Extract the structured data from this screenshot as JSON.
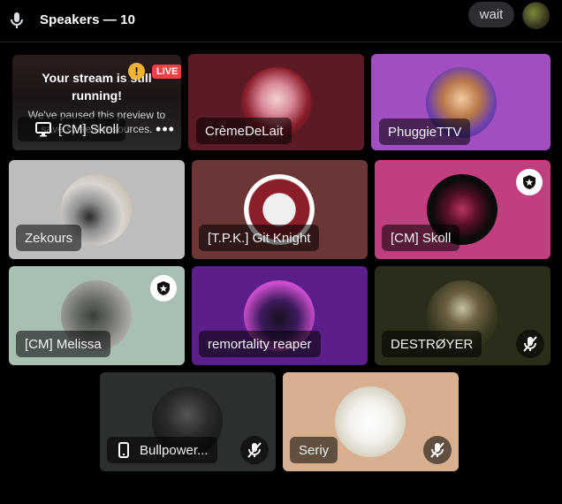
{
  "header": {
    "title": "Speakers — 10",
    "wait_label": "wait",
    "mic_icon": "microphone-icon",
    "avatar": "user-avatar"
  },
  "stream": {
    "title_line1": "Your stream is still",
    "title_line2": "running!",
    "subtitle_line1": "We've paused this preview to",
    "subtitle_line2": "save system resources.",
    "live_label": "LIVE",
    "name": "[CM] Skoll",
    "screen_icon": "monitor-icon",
    "more_icon": "more-options-icon",
    "warning_icon": "warning-icon",
    "warning_glyph": "!",
    "more_glyph": "•••"
  },
  "tiles": [
    {
      "name": "CrèmeDeLait",
      "bg": "#5c1a24"
    },
    {
      "name": "PhuggieTTV",
      "bg": "#a14ec1"
    },
    {
      "name": "Zekours",
      "bg": "#bdbdbd"
    },
    {
      "name": "[T.P.K.] Git Knight",
      "bg": "#6b3636"
    },
    {
      "name": "[CM] Skoll",
      "bg": "#c23f7f"
    },
    {
      "name": "[CM] Melissa",
      "bg": "#a9bfb1"
    },
    {
      "name": "remortality reaper",
      "bg": "#5c1f8a"
    },
    {
      "name": "DESTRØYER",
      "bg": "#2b2c1a"
    },
    {
      "name": "Bullpower...",
      "bg": "#2b302d"
    },
    {
      "name": "Seriy",
      "bg": "#d8b08f"
    }
  ],
  "icons": {
    "moderator": "shield-star-icon",
    "muted": "mic-muted-icon",
    "phone": "mobile-icon"
  }
}
